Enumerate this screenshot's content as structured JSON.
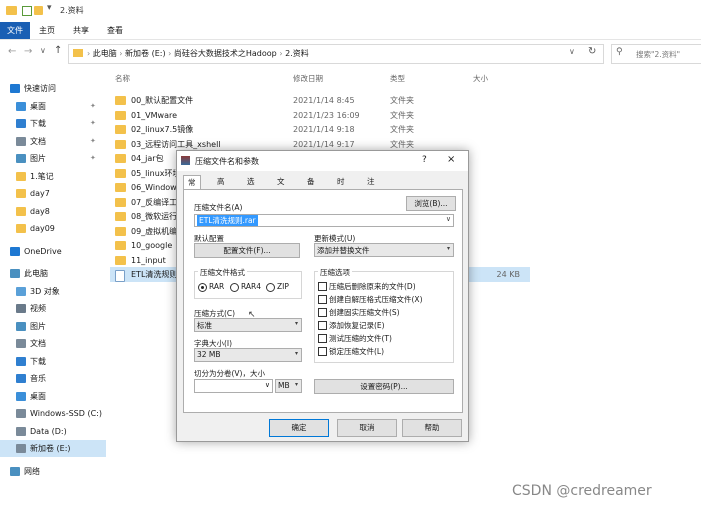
{
  "window": {
    "title": "2.资料",
    "ribbon_tabs": [
      "文件",
      "主页",
      "共享",
      "查看"
    ],
    "breadcrumb": [
      "此电脑",
      "新加卷 (E:)",
      "尚硅谷大数据技术之Hadoop",
      "2.资料"
    ],
    "search_placeholder": "搜索\"2.资料\""
  },
  "columns": {
    "name": "名称",
    "date": "修改日期",
    "type": "类型",
    "size": "大小"
  },
  "nav": [
    {
      "label": "快速访问",
      "icon": "star-icon",
      "color": "#1e78d2",
      "indent": 0,
      "pin": false
    },
    {
      "label": "桌面",
      "icon": "desktop-icon",
      "color": "#3b8fd9",
      "indent": 1,
      "pin": true
    },
    {
      "label": "下载",
      "icon": "download-icon",
      "color": "#2f7fd0",
      "indent": 1,
      "pin": true
    },
    {
      "label": "文档",
      "icon": "document-icon",
      "color": "#7a8a99",
      "indent": 1,
      "pin": true
    },
    {
      "label": "图片",
      "icon": "picture-icon",
      "color": "#4a90c0",
      "indent": 1,
      "pin": true
    },
    {
      "label": "1.笔记",
      "icon": "folder-icon",
      "color": "#f3c14b",
      "indent": 1,
      "pin": false
    },
    {
      "label": "day7",
      "icon": "folder-icon",
      "color": "#f3c14b",
      "indent": 1,
      "pin": false
    },
    {
      "label": "day8",
      "icon": "folder-icon",
      "color": "#f3c14b",
      "indent": 1,
      "pin": false
    },
    {
      "label": "day09",
      "icon": "folder-icon",
      "color": "#f3c14b",
      "indent": 1,
      "pin": false
    },
    {
      "label": "OneDrive",
      "icon": "cloud-icon",
      "color": "#1e78d2",
      "indent": 0,
      "pin": false,
      "gap": true
    },
    {
      "label": "此电脑",
      "icon": "computer-icon",
      "color": "#4a90c0",
      "indent": 0,
      "pin": false,
      "gap": true
    },
    {
      "label": "3D 对象",
      "icon": "cube-icon",
      "color": "#5aa0d8",
      "indent": 1,
      "pin": false
    },
    {
      "label": "视频",
      "icon": "video-icon",
      "color": "#6a7a8a",
      "indent": 1,
      "pin": false
    },
    {
      "label": "图片",
      "icon": "picture-icon",
      "color": "#4a90c0",
      "indent": 1,
      "pin": false
    },
    {
      "label": "文档",
      "icon": "document-icon",
      "color": "#7a8a99",
      "indent": 1,
      "pin": false
    },
    {
      "label": "下载",
      "icon": "download-icon",
      "color": "#2f7fd0",
      "indent": 1,
      "pin": false
    },
    {
      "label": "音乐",
      "icon": "music-icon",
      "color": "#2f7fd0",
      "indent": 1,
      "pin": false
    },
    {
      "label": "桌面",
      "icon": "desktop-icon",
      "color": "#3b8fd9",
      "indent": 1,
      "pin": false
    },
    {
      "label": "Windows-SSD (C:)",
      "icon": "drive-icon",
      "color": "#7a8a99",
      "indent": 1,
      "pin": false
    },
    {
      "label": "Data (D:)",
      "icon": "drive-icon",
      "color": "#7a8a99",
      "indent": 1,
      "pin": false
    },
    {
      "label": "新加卷 (E:)",
      "icon": "drive-icon",
      "color": "#7a8a99",
      "indent": 1,
      "pin": false,
      "selected": true
    },
    {
      "label": "网络",
      "icon": "network-icon",
      "color": "#4a90c0",
      "indent": 0,
      "pin": false,
      "gap": true
    }
  ],
  "files": [
    {
      "name": "00_默认配置文件",
      "date": "2021/1/14 8:45",
      "type": "文件夹",
      "size": ""
    },
    {
      "name": "01_VMware",
      "date": "2021/1/23 16:09",
      "type": "文件夹",
      "size": ""
    },
    {
      "name": "02_linux7.5镜像",
      "date": "2021/1/14 9:18",
      "type": "文件夹",
      "size": ""
    },
    {
      "name": "03_远程访问工具_xshell",
      "date": "2021/1/14 9:17",
      "type": "文件夹",
      "size": ""
    },
    {
      "name": "04_jar包",
      "date": "",
      "type": "",
      "size": ""
    },
    {
      "name": "05_linux环境",
      "date": "",
      "type": "",
      "size": ""
    },
    {
      "name": "06_Windows",
      "date": "",
      "type": "",
      "size": ""
    },
    {
      "name": "07_反编译工具",
      "date": "",
      "type": "",
      "size": ""
    },
    {
      "name": "08_微软运行库",
      "date": "",
      "type": "",
      "size": ""
    },
    {
      "name": "09_虚拟机编程",
      "date": "",
      "type": "",
      "size": ""
    },
    {
      "name": "10_google",
      "date": "",
      "type": "",
      "size": ""
    },
    {
      "name": "11_input",
      "date": "",
      "type": "",
      "size": ""
    },
    {
      "name": "ETL清洗规则",
      "date": "",
      "type": "",
      "size": "24 KB",
      "selected": true,
      "file": true
    }
  ],
  "dialog": {
    "title": "压缩文件名和参数",
    "help_glyph": "?",
    "close_glyph": "×",
    "tabs": [
      "常规",
      "高级",
      "选项",
      "文件",
      "备份",
      "时间",
      "注释"
    ],
    "archive_name_label": "压缩文件名(A)",
    "archive_name_value": "ETL清洗规则.rar",
    "browse": "浏览(B)...",
    "profile_label": "默认配置",
    "profile_button": "配置文件(F)...",
    "update_mode_label": "更新模式(U)",
    "update_mode_value": "添加并替换文件",
    "format_label": "压缩文件格式",
    "formats": [
      "RAR",
      "RAR4",
      "ZIP"
    ],
    "method_label": "压缩方式(C)",
    "method_value": "标准",
    "dict_label": "字典大小(I)",
    "dict_value": "32 MB",
    "split_label": "切分为分卷(V)，大小",
    "split_unit": "MB",
    "options_label": "压缩选项",
    "options": [
      "压缩后删除原来的文件(D)",
      "创建自解压格式压缩文件(X)",
      "创建固实压缩文件(S)",
      "添加恢复记录(E)",
      "测试压缩的文件(T)",
      "锁定压缩文件(L)"
    ],
    "password_button": "设置密码(P)...",
    "ok": "确定",
    "cancel": "取消",
    "help": "帮助"
  },
  "watermark": "CSDN @credreamer"
}
